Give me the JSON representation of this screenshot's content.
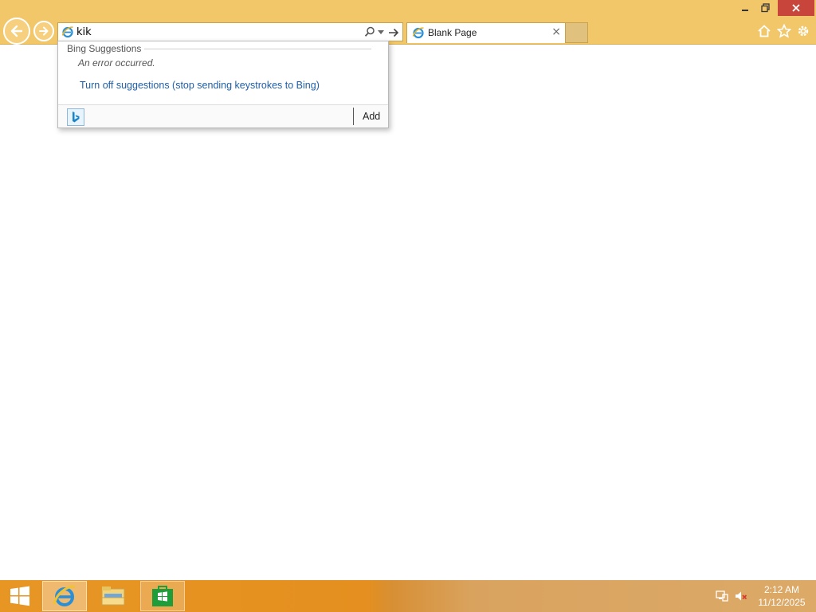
{
  "browser": {
    "address_value": "kik",
    "tab": {
      "title": "Blank Page",
      "close_symbol": "×"
    },
    "window_controls": {
      "minimize": "–",
      "restore": "❐",
      "close": "✕"
    }
  },
  "suggestions": {
    "header": "Bing Suggestions",
    "error_message": "An error occurred.",
    "turn_off_link": "Turn off suggestions (stop sending keystrokes to Bing)",
    "add_label": "Add"
  },
  "taskbar": {
    "apps": [
      "internet-explorer",
      "file-explorer",
      "windows-store"
    ],
    "clock": {
      "time": "2:12 AM",
      "date": "11/12/2025"
    }
  },
  "colors": {
    "chrome": "#f2c76a",
    "link": "#1f5ea8",
    "close_button": "#c7453b",
    "taskbar": "#e48f1f"
  }
}
